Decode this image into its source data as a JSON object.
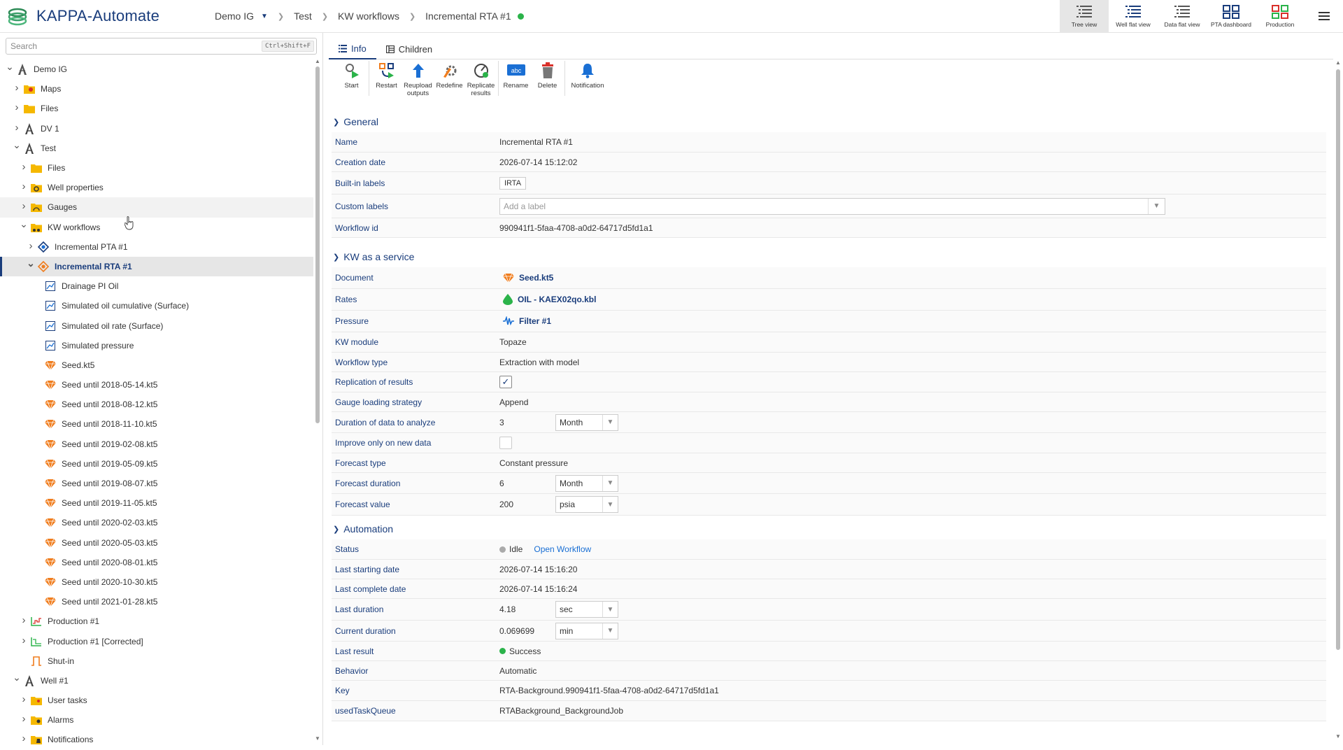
{
  "app": {
    "title": "KAPPA-Automate"
  },
  "breadcrumb": {
    "items": [
      "Demo IG",
      "Test",
      "KW workflows",
      "Incremental RTA #1"
    ]
  },
  "views": [
    {
      "label": "Tree view",
      "icon": "tree-view-icon"
    },
    {
      "label": "Well flat view",
      "icon": "well-flat-view-icon"
    },
    {
      "label": "Data flat view",
      "icon": "data-flat-view-icon"
    },
    {
      "label": "PTA dashboard",
      "icon": "pta-dashboard-icon"
    },
    {
      "label": "Production",
      "icon": "production-icon"
    }
  ],
  "search": {
    "placeholder": "Search",
    "shortcut": "Ctrl+Shift+F"
  },
  "tree": [
    {
      "label": "Demo IG",
      "depth": 0,
      "chev": "v",
      "icon": "field"
    },
    {
      "label": "Maps",
      "depth": 1,
      "chev": ">",
      "icon": "folder-map"
    },
    {
      "label": "Files",
      "depth": 1,
      "chev": ">",
      "icon": "folder"
    },
    {
      "label": "DV 1",
      "depth": 1,
      "chev": ">",
      "icon": "well"
    },
    {
      "label": "Test",
      "depth": 1,
      "chev": "v",
      "icon": "well"
    },
    {
      "label": "Files",
      "depth": 2,
      "chev": ">",
      "icon": "folder"
    },
    {
      "label": "Well properties",
      "depth": 2,
      "chev": ">",
      "icon": "folder-gear"
    },
    {
      "label": "Gauges",
      "depth": 2,
      "chev": ">",
      "icon": "folder-gauge"
    },
    {
      "label": "KW workflows",
      "depth": 2,
      "chev": "v",
      "icon": "folder-workflow"
    },
    {
      "label": "Incremental PTA #1",
      "depth": 3,
      "chev": ">",
      "icon": "workflow-blue"
    },
    {
      "label": "Incremental RTA #1",
      "depth": 3,
      "chev": "v",
      "icon": "workflow-orange"
    },
    {
      "label": "Drainage PI Oil",
      "depth": 4,
      "chev": "",
      "icon": "chart"
    },
    {
      "label": "Simulated oil cumulative (Surface)",
      "depth": 4,
      "chev": "",
      "icon": "chart"
    },
    {
      "label": "Simulated oil rate (Surface)",
      "depth": 4,
      "chev": "",
      "icon": "chart"
    },
    {
      "label": "Simulated pressure",
      "depth": 4,
      "chev": "",
      "icon": "chart"
    },
    {
      "label": "Seed.kt5",
      "depth": 4,
      "chev": "",
      "icon": "gem"
    },
    {
      "label": "Seed until 2018-05-14.kt5",
      "depth": 4,
      "chev": "",
      "icon": "gem"
    },
    {
      "label": "Seed until 2018-08-12.kt5",
      "depth": 4,
      "chev": "",
      "icon": "gem"
    },
    {
      "label": "Seed until 2018-11-10.kt5",
      "depth": 4,
      "chev": "",
      "icon": "gem"
    },
    {
      "label": "Seed until 2019-02-08.kt5",
      "depth": 4,
      "chev": "",
      "icon": "gem"
    },
    {
      "label": "Seed until 2019-05-09.kt5",
      "depth": 4,
      "chev": "",
      "icon": "gem"
    },
    {
      "label": "Seed until 2019-08-07.kt5",
      "depth": 4,
      "chev": "",
      "icon": "gem"
    },
    {
      "label": "Seed until 2019-11-05.kt5",
      "depth": 4,
      "chev": "",
      "icon": "gem"
    },
    {
      "label": "Seed until 2020-02-03.kt5",
      "depth": 4,
      "chev": "",
      "icon": "gem"
    },
    {
      "label": "Seed until 2020-05-03.kt5",
      "depth": 4,
      "chev": "",
      "icon": "gem"
    },
    {
      "label": "Seed until 2020-08-01.kt5",
      "depth": 4,
      "chev": "",
      "icon": "gem"
    },
    {
      "label": "Seed until 2020-10-30.kt5",
      "depth": 4,
      "chev": "",
      "icon": "gem"
    },
    {
      "label": "Seed until 2021-01-28.kt5",
      "depth": 4,
      "chev": "",
      "icon": "gem"
    },
    {
      "label": "Production #1",
      "depth": 2,
      "chev": ">",
      "icon": "production"
    },
    {
      "label": "Production #1 [Corrected]",
      "depth": 2,
      "chev": ">",
      "icon": "production-corrected"
    },
    {
      "label": "Shut-in",
      "depth": 2,
      "chev": "",
      "icon": "shutin"
    },
    {
      "label": "Well #1",
      "depth": 1,
      "chev": "v",
      "icon": "well"
    },
    {
      "label": "User tasks",
      "depth": 2,
      "chev": ">",
      "icon": "folder-user"
    },
    {
      "label": "Alarms",
      "depth": 2,
      "chev": ">",
      "icon": "folder-alarm"
    },
    {
      "label": "Notifications",
      "depth": 2,
      "chev": ">",
      "icon": "folder-bell"
    }
  ],
  "tabs": {
    "info": "Info",
    "children": "Children"
  },
  "toolbar": {
    "start": "Start",
    "restart": "Restart",
    "reupload_line1": "Reupload",
    "reupload_line2": "outputs",
    "redefine": "Redefine",
    "replicate_line1": "Replicate",
    "replicate_line2": "results",
    "rename": "Rename",
    "delete": "Delete",
    "notification": "Notification"
  },
  "general": {
    "title": "General",
    "name_k": "Name",
    "name_v": "Incremental RTA #1",
    "creation_k": "Creation date",
    "creation_v": "2026-07-14 15:12:02",
    "builtin_k": "Built-in labels",
    "builtin_v": "IRTA",
    "custom_k": "Custom labels",
    "custom_placeholder": "Add a label",
    "workflow_id_k": "Workflow id",
    "workflow_id_v": "990941f1-5faa-4708-a0d2-64717d5fd1a1"
  },
  "kw": {
    "title": "KW as a service",
    "document_k": "Document",
    "document_v": "Seed.kt5",
    "rates_k": "Rates",
    "rates_v": "OIL - KAEX02qo.kbl",
    "pressure_k": "Pressure",
    "pressure_v": "Filter #1",
    "module_k": "KW module",
    "module_v": "Topaze",
    "wtype_k": "Workflow type",
    "wtype_v": "Extraction with model",
    "replication_k": "Replication of results",
    "replication_checked": true,
    "gauge_k": "Gauge loading strategy",
    "gauge_v": "Append",
    "duration_k": "Duration of data to analyze",
    "duration_v": "3",
    "duration_unit": "Month",
    "improve_k": "Improve only on new data",
    "improve_checked": false,
    "ftype_k": "Forecast type",
    "ftype_v": "Constant pressure",
    "fduration_k": "Forecast duration",
    "fduration_v": "6",
    "fduration_unit": "Month",
    "fvalue_k": "Forecast value",
    "fvalue_v": "200",
    "fvalue_unit": "psia"
  },
  "automation": {
    "title": "Automation",
    "status_k": "Status",
    "status_v": "Idle",
    "open_link": "Open Workflow",
    "last_start_k": "Last starting date",
    "last_start_v": "2026-07-14 15:16:20",
    "last_complete_k": "Last complete date",
    "last_complete_v": "2026-07-14 15:16:24",
    "last_duration_k": "Last duration",
    "last_duration_v": "4.18",
    "last_duration_unit": "sec",
    "cur_duration_k": "Current duration",
    "cur_duration_v": "0.069699",
    "cur_duration_unit": "min",
    "last_result_k": "Last result",
    "last_result_v": "Success",
    "behavior_k": "Behavior",
    "behavior_v": "Automatic",
    "key_k": "Key",
    "key_v": "RTA-Background.990941f1-5faa-4708-a0d2-64717d5fd1a1",
    "queue_k": "usedTaskQueue",
    "queue_v": "RTABackground_BackgroundJob"
  },
  "colors": {
    "brand": "#1a3d7c",
    "success": "#2bb34a",
    "idle": "#999999",
    "orange": "#f07d1e",
    "folder": "#f5b800"
  }
}
